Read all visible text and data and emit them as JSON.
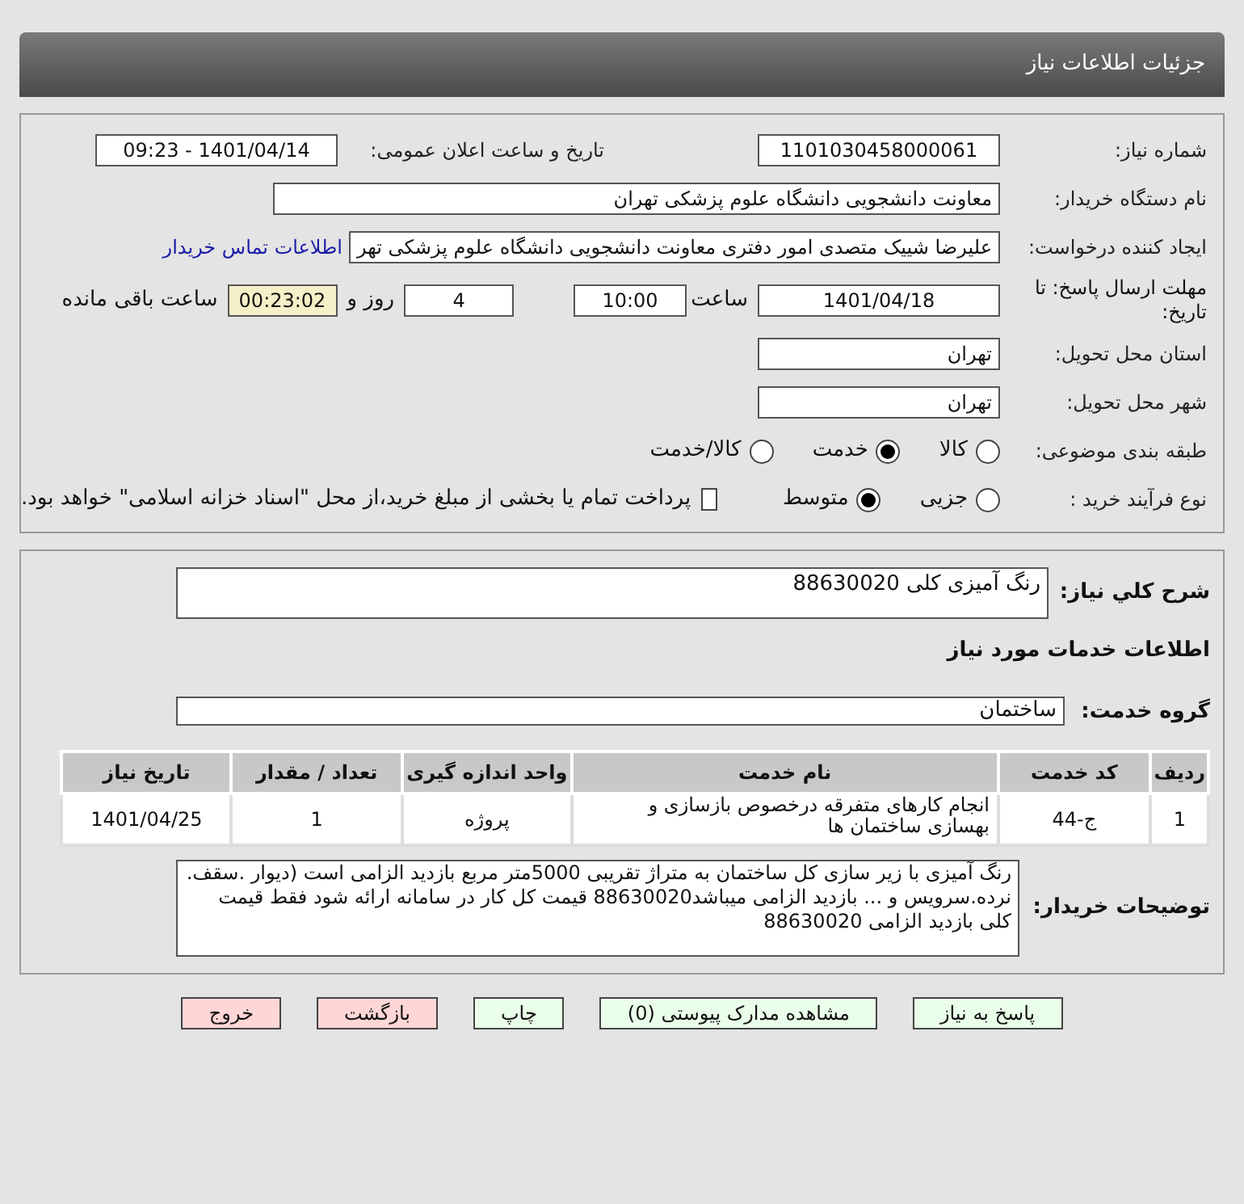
{
  "header": {
    "title": "جزئیات اطلاعات نیاز"
  },
  "need_number": {
    "label": "شماره نیاز:",
    "value": "1101030458000061"
  },
  "announce": {
    "label": "تاریخ و ساعت اعلان عمومی:",
    "value": "1401/04/14 - 09:23"
  },
  "buyer": {
    "label": "نام دستگاه خریدار:",
    "value": "معاونت دانشجویی دانشگاه علوم پزشکی تهران"
  },
  "creator": {
    "label": "ایجاد کننده درخواست:",
    "value": "علیرضا شییک متصدی امور دفتری معاونت دانشجویی دانشگاه علوم پزشکی تهر",
    "link": "اطلاعات تماس خریدار"
  },
  "deadline": {
    "label": "مهلت ارسال پاسخ: تا تاریخ:",
    "date": "1401/04/18",
    "time_label": "ساعت",
    "time": "10:00",
    "days": "4",
    "days_label": "روز و",
    "remaining": "00:23:02",
    "remaining_label": "ساعت باقی مانده"
  },
  "province": {
    "label": "استان محل تحویل:",
    "value": "تهران"
  },
  "city": {
    "label": "شهر محل تحویل:",
    "value": "تهران"
  },
  "category": {
    "label": "طبقه بندی موضوعی:",
    "options": [
      {
        "label": "کالا",
        "selected": false
      },
      {
        "label": "خدمت",
        "selected": true
      },
      {
        "label": "کالا/خدمت",
        "selected": false
      }
    ]
  },
  "process": {
    "label": "نوع فرآیند خرید :",
    "options": [
      {
        "label": "جزیی",
        "selected": false
      },
      {
        "label": "متوسط",
        "selected": true
      }
    ],
    "payment": {
      "checked": false,
      "text": "پرداخت تمام یا بخشی از مبلغ خرید،از محل \"اسناد خزانه اسلامی\" خواهد بود."
    }
  },
  "summary": {
    "label": "شرح کلي نياز:",
    "value": "رنگ آمیزی کلی 88630020"
  },
  "services_title": "اطلاعات خدمات مورد نیاز",
  "service_group": {
    "label": "گروه خدمت:",
    "value": "ساختمان"
  },
  "table": {
    "columns": [
      "ردیف",
      "کد خدمت",
      "نام خدمت",
      "واحد اندازه گیری",
      "تعداد / مقدار",
      "تاریخ نیاز"
    ],
    "rows": [
      [
        "1",
        "ج-44",
        "انجام کارهای متفرقه درخصوص بازسازی و بهسازی ساختمان ها",
        "پروژه",
        "1",
        "1401/04/25"
      ]
    ]
  },
  "buyer_notes": {
    "label": "توضیحات خریدار:",
    "value": "رنگ آمیزی با زیر سازی کل ساختمان به متراژ تقریبی 5000متر مربع   بازدید الزامی است  (دیوار .سقف. نرده.سرویس و ... بازدید الزامی میباشد88630020 قیمت کل کار در سامانه ارائه شود  فقط قیمت کلی بازدید الزامی 88630020"
  },
  "buttons": [
    {
      "label": "پاسخ به نیاز",
      "kind": "primary"
    },
    {
      "label": "مشاهده مدارک پیوستی (0)",
      "kind": "primary"
    },
    {
      "label": "چاپ",
      "kind": "primary"
    },
    {
      "label": "بازگشت",
      "kind": "danger"
    },
    {
      "label": "خروج",
      "kind": "danger"
    }
  ]
}
